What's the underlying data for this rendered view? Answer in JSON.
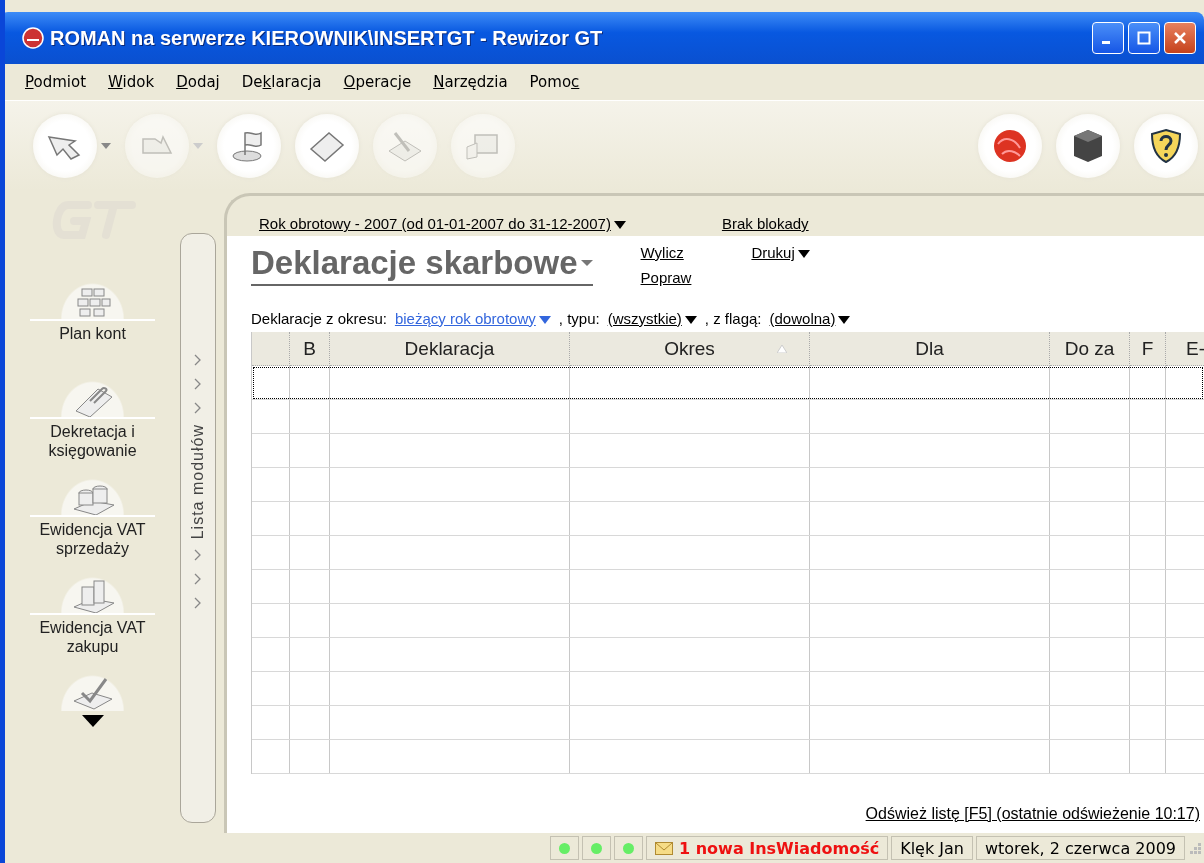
{
  "window": {
    "title": "ROMAN na serwerze KIEROWNIK\\INSERTGT - Rewizor GT"
  },
  "menu": [
    {
      "key": "P",
      "after": "odmiot"
    },
    {
      "key": "W",
      "after": "idok"
    },
    {
      "key": "D",
      "after": "odaj"
    },
    {
      "before": "De",
      "key": "k",
      "after": "laracja"
    },
    {
      "key": "O",
      "after": "peracje"
    },
    {
      "key": "N",
      "after": "arzędzia"
    },
    {
      "before": "Pomo",
      "key": "c"
    }
  ],
  "toolbar": {
    "left": [
      {
        "kind": "back",
        "dropdown": true,
        "disabled": false
      },
      {
        "kind": "forward",
        "dropdown": true,
        "disabled": true
      },
      {
        "kind": "flag",
        "dropdown": false,
        "disabled": false
      },
      {
        "kind": "page",
        "dropdown": false,
        "disabled": false
      },
      {
        "kind": "edit",
        "dropdown": false,
        "disabled": true
      },
      {
        "kind": "print",
        "dropdown": false,
        "disabled": true
      }
    ],
    "right": [
      {
        "kind": "globe"
      },
      {
        "kind": "cube"
      },
      {
        "kind": "help"
      }
    ]
  },
  "sidebar": {
    "items": [
      {
        "kind": "blocks",
        "label": "Plan kont"
      },
      {
        "kind": "clip",
        "label": "Dekretacja i księgowanie"
      },
      {
        "kind": "coins",
        "label": "Ewidencja VAT sprzedaży"
      },
      {
        "kind": "books",
        "label": "Ewidencja VAT zakupu"
      },
      {
        "kind": "check"
      }
    ],
    "tab": "Lista modułów"
  },
  "header": {
    "year": "Rok obrotowy - 2007  (od 01-01-2007 do 31-12-2007)",
    "lock": "Brak blokady"
  },
  "title": "Deklaracje skarbowe",
  "actions": [
    "Wylicz",
    "Popraw"
  ],
  "print": "Drukuj",
  "filters": {
    "period_label": "Deklaracje z okresu:",
    "period": "bieżący rok obrotowy",
    "type_label": ", typu:",
    "type": "(wszystkie)",
    "flag_label": ", z flagą:",
    "flag": "(dowolna)"
  },
  "table": {
    "columns": [
      {
        "sorted": false
      },
      {
        "label": "B",
        "sorted": false
      },
      {
        "label": "Deklaracja",
        "sorted": false
      },
      {
        "label": "Okres",
        "sorted": true
      },
      {
        "label": "Dla",
        "sorted": false
      },
      {
        "label": "Do za",
        "sorted": false
      },
      {
        "label": "F",
        "sorted": false
      },
      {
        "label": "E-",
        "sorted": false
      }
    ]
  },
  "refresh": "Odśwież listę [F5] (ostatnie odświeżenie 10:17)",
  "status_bar": {
    "indicators": [
      {
        "color": "#66ee66"
      },
      {
        "color": "#66ee66"
      },
      {
        "color": "#66ee66"
      }
    ],
    "message": "1 nowa InsWiadomość",
    "user": "Klęk Jan",
    "date": "wtorek, 2 czerwca 2009"
  }
}
